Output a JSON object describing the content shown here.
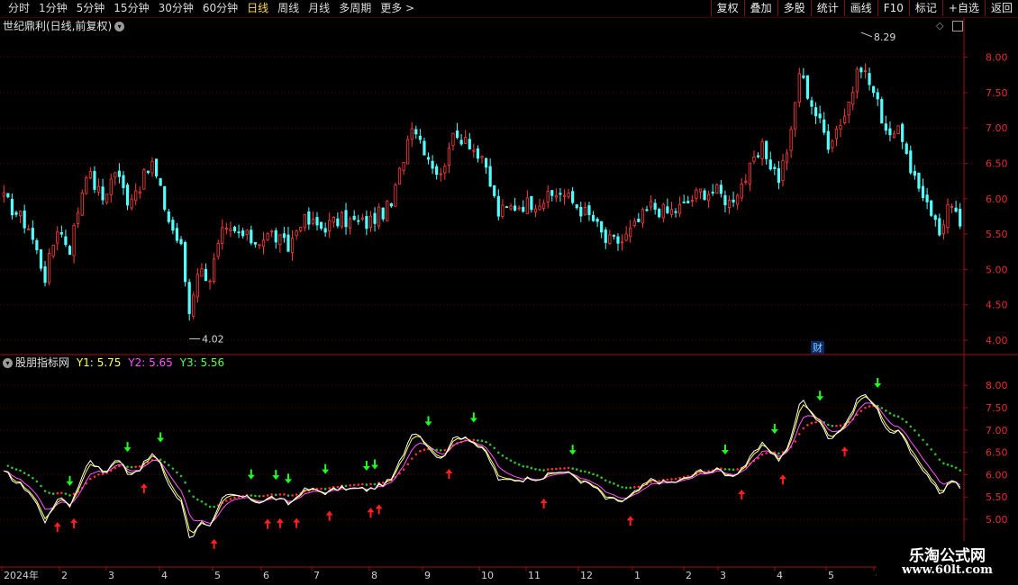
{
  "toolbar": {
    "periods": [
      {
        "label": "分时",
        "active": false
      },
      {
        "label": "1分钟",
        "active": false
      },
      {
        "label": "5分钟",
        "active": false
      },
      {
        "label": "15分钟",
        "active": false
      },
      {
        "label": "30分钟",
        "active": false
      },
      {
        "label": "60分钟",
        "active": false
      },
      {
        "label": "日线",
        "active": true
      },
      {
        "label": "周线",
        "active": false
      },
      {
        "label": "月线",
        "active": false
      },
      {
        "label": "多周期",
        "active": false
      },
      {
        "label": "更多 >",
        "active": false
      }
    ],
    "buttons": [
      "复权",
      "叠加",
      "多股",
      "统计",
      "画线",
      "F10",
      "标记",
      "+自选",
      "返回"
    ]
  },
  "main_panel": {
    "title": "世纪鼎利(日线,前复权)",
    "high_label": "8.29",
    "low_label": "4.02",
    "finance_badge": "财",
    "y_ticks": [
      "8.00",
      "7.50",
      "7.00",
      "6.50",
      "6.00",
      "5.50",
      "5.00",
      "4.50",
      "4.00"
    ]
  },
  "indicator_panel": {
    "name": "股朋指标网",
    "y1_label": "Y1:",
    "y1_value": "5.75",
    "y2_label": "Y2:",
    "y2_value": "5.65",
    "y3_label": "Y3:",
    "y3_value": "5.56",
    "y_ticks": [
      "8.00",
      "7.50",
      "7.00",
      "6.50",
      "6.00",
      "5.50",
      "5.00"
    ]
  },
  "x_axis": {
    "labels": [
      "2024年",
      "2",
      "3",
      "4",
      "5",
      "6",
      "7",
      "8",
      "9",
      "10",
      "11",
      "12",
      "1",
      "2",
      "3",
      "4",
      "5",
      "6"
    ]
  },
  "watermark": {
    "line1": "乐淘公式网",
    "line2": "www.60lt.com"
  },
  "colors": {
    "up": "#ff3c3c",
    "down": "#54ffff",
    "y1": "#ffff55",
    "y2": "#ff55ff",
    "y3": "#55ff55",
    "grid": "#5a0000",
    "axis": "#a01010"
  },
  "chart_data": {
    "type": "candlestick",
    "title": "世纪鼎利(日线,前复权)",
    "ylim": [
      3.85,
      8.45
    ],
    "close_path": [
      [
        0,
        6.0
      ],
      [
        6,
        5.6
      ],
      [
        10,
        4.9
      ],
      [
        13,
        5.6
      ],
      [
        16,
        5.3
      ],
      [
        20,
        6.4
      ],
      [
        24,
        6.0
      ],
      [
        27,
        6.4
      ],
      [
        30,
        6.0
      ],
      [
        33,
        6.2
      ],
      [
        36,
        6.5
      ],
      [
        40,
        5.7
      ],
      [
        43,
        5.3
      ],
      [
        45,
        4.4
      ],
      [
        47,
        5.0
      ],
      [
        50,
        4.9
      ],
      [
        53,
        5.5
      ],
      [
        57,
        5.5
      ],
      [
        61,
        5.4
      ],
      [
        65,
        5.5
      ],
      [
        69,
        5.3
      ],
      [
        72,
        5.7
      ],
      [
        77,
        5.6
      ],
      [
        82,
        5.7
      ],
      [
        88,
        5.65
      ],
      [
        94,
        5.9
      ],
      [
        97,
        6.6
      ],
      [
        99,
        7.1
      ],
      [
        103,
        6.6
      ],
      [
        106,
        6.3
      ],
      [
        108,
        6.8
      ],
      [
        112,
        6.9
      ],
      [
        117,
        6.4
      ],
      [
        120,
        5.8
      ],
      [
        124,
        5.9
      ],
      [
        128,
        5.95
      ],
      [
        132,
        6.0
      ],
      [
        135,
        6.1
      ],
      [
        139,
        5.9
      ],
      [
        143,
        5.7
      ],
      [
        146,
        5.4
      ],
      [
        150,
        5.4
      ],
      [
        153,
        5.6
      ],
      [
        157,
        5.9
      ],
      [
        161,
        5.8
      ],
      [
        165,
        5.9
      ],
      [
        169,
        6.1
      ],
      [
        173,
        6.1
      ],
      [
        176,
        5.95
      ],
      [
        180,
        6.3
      ],
      [
        184,
        6.7
      ],
      [
        188,
        6.3
      ],
      [
        191,
        6.9
      ],
      [
        193,
        7.8
      ],
      [
        197,
        7.2
      ],
      [
        200,
        6.8
      ],
      [
        204,
        7.2
      ],
      [
        208,
        7.9
      ],
      [
        211,
        7.5
      ],
      [
        214,
        7.0
      ],
      [
        218,
        6.9
      ],
      [
        220,
        6.3
      ],
      [
        224,
        6.0
      ],
      [
        227,
        5.5
      ],
      [
        229,
        5.9
      ],
      [
        232,
        5.65
      ]
    ],
    "indicator_series": [
      {
        "name": "Y1",
        "last": 5.75
      },
      {
        "name": "Y2",
        "last": 5.65
      },
      {
        "name": "Y3",
        "last": 5.56
      }
    ]
  }
}
